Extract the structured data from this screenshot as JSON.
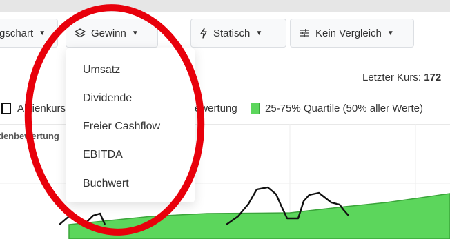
{
  "toolbar": {
    "chart_type_label": "gschart",
    "metric_label": "Gewinn",
    "mode_label": "Statisch",
    "comparison_label": "Kein Vergleich"
  },
  "metric_menu": {
    "items": [
      "Umsatz",
      "Dividende",
      "Freier Cashflow",
      "EBITDA",
      "Buchwert"
    ]
  },
  "price": {
    "label": "Letzter Kurs:",
    "value": "172"
  },
  "legend": {
    "price_label": "Aktienkurs",
    "valuation_label": "ewertung",
    "quartile_label": "25-75% Quartile (50% aller Werte)"
  },
  "chart": {
    "title": "tienbewertung"
  },
  "colors": {
    "annotation_ellipse": "#e8000b",
    "quartile_fill": "#5cd65c",
    "price_line": "#111111"
  }
}
